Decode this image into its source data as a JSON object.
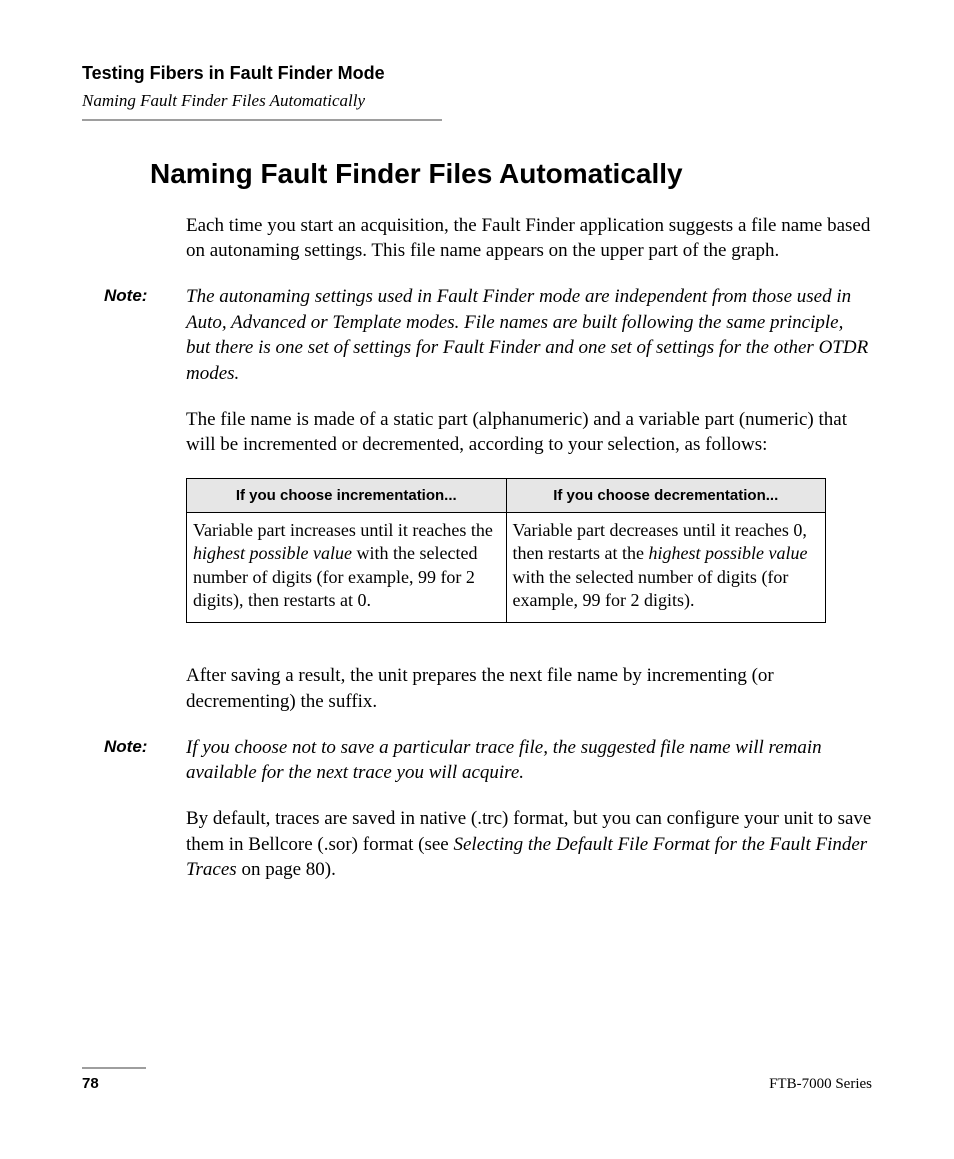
{
  "header": {
    "chapter": "Testing Fibers in Fault Finder Mode",
    "section": "Naming Fault Finder Files Automatically"
  },
  "title": "Naming Fault Finder Files Automatically",
  "para1": "Each time you start an acquisition, the Fault Finder application suggests a file name based on autonaming settings. This file name appears on the upper part of the graph.",
  "note1_label": "Note:",
  "note1_text": "The autonaming settings used in Fault Finder mode are independent from those used in Auto, Advanced or Template modes. File names are built following the same principle, but there is one set of settings for Fault Finder and one set of settings for the other OTDR modes.",
  "para2": "The file name is made of a static part (alphanumeric) and a variable part (numeric) that will be incremented or decremented, according to your selection, as follows:",
  "table": {
    "h1": "If you choose incrementation...",
    "h2": "If you choose decrementation...",
    "c1_a": "Variable part increases until it reaches the ",
    "c1_i": "highest possible value",
    "c1_b": " with the selected number of digits (for example, 99 for 2 digits), then restarts at 0.",
    "c2_a": "Variable part decreases until it reaches 0, then restarts at the ",
    "c2_i": "highest possible value",
    "c2_b": " with the selected number of digits (for example, 99 for 2 digits)."
  },
  "para3": "After saving a result, the unit prepares the next file name by incrementing (or decrementing) the suffix.",
  "note2_label": "Note:",
  "note2_text": "If you choose not to save a particular trace file, the suggested file name will remain available for the next trace you will acquire.",
  "para4_a": "By default, traces are saved in native (.trc) format, but you can configure your unit to save them in Bellcore (.sor) format (see ",
  "para4_ref": "Selecting the Default File Format for the Fault Finder Traces",
  "para4_b": " on page 80).",
  "footer": {
    "page": "78",
    "series": "FTB-7000 Series"
  }
}
